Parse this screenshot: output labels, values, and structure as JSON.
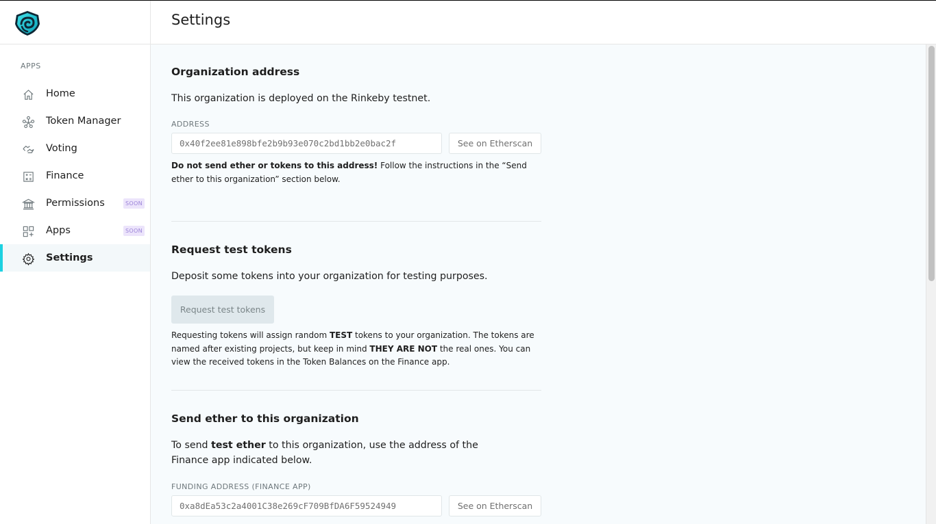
{
  "sidebar": {
    "apps_heading": "APPS",
    "items": [
      {
        "label": "Home",
        "icon": "home-icon"
      },
      {
        "label": "Token Manager",
        "icon": "token-manager-icon"
      },
      {
        "label": "Voting",
        "icon": "voting-icon"
      },
      {
        "label": "Finance",
        "icon": "finance-icon"
      },
      {
        "label": "Permissions",
        "icon": "permissions-icon",
        "badge": "SOON"
      },
      {
        "label": "Apps",
        "icon": "apps-icon",
        "badge": "SOON"
      },
      {
        "label": "Settings",
        "icon": "gear-icon",
        "active": true
      }
    ]
  },
  "header": {
    "title": "Settings"
  },
  "org_address": {
    "title": "Organization address",
    "description": "This organization is deployed on the Rinkeby testnet.",
    "field_label": "ADDRESS",
    "address": "0x40f2ee81e898bfe2b9b93e070c2bd1bb2e0bac2f",
    "etherscan_label": "See on Etherscan",
    "warning_bold": "Do not send ether or tokens to this address!",
    "warning_rest": " Follow the instructions in the “Send ether to this organization” section below."
  },
  "test_tokens": {
    "title": "Request test tokens",
    "description": "Deposit some tokens into your organization for testing purposes.",
    "button_label": "Request test tokens",
    "note_1": "Requesting tokens will assign random ",
    "note_bold_1": "TEST",
    "note_2": " tokens to your organization. The tokens are named after existing projects, but keep in mind ",
    "note_bold_2": "THEY ARE NOT",
    "note_3": " the real ones. You can view the received tokens in the Token Balances on the Finance app."
  },
  "send_ether": {
    "title": "Send ether to this organization",
    "desc_1": "To send ",
    "desc_bold": "test ether",
    "desc_2": " to this organization, use the address of the Finance app indicated below.",
    "field_label": "FUNDING ADDRESS (FINANCE APP)",
    "address": "0xa8dEa53c2a4001C38e269cF709BfDA6F59524949",
    "etherscan_label": "See on Etherscan"
  },
  "colors": {
    "accent": "#1dd1e1",
    "soon_badge_bg": "#ece4fb",
    "soon_badge_text": "#9b83d8",
    "main_bg": "#f7fbfd"
  }
}
